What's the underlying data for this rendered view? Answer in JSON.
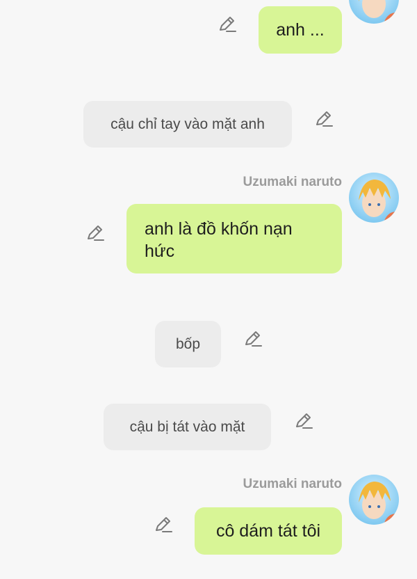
{
  "messages": [
    {
      "role": "user",
      "text": "anh ..."
    },
    {
      "role": "narration",
      "text": "cậu chỉ tay vào mặt anh"
    },
    {
      "role": "user",
      "name": "Uzumaki naruto",
      "text": "anh là đồ khốn nạn hức"
    },
    {
      "role": "narration",
      "text": "bốp"
    },
    {
      "role": "narration",
      "text": "cậu bị tát vào mặt"
    },
    {
      "role": "user",
      "name": "Uzumaki naruto",
      "text": "cô dám tát tôi"
    }
  ],
  "icons": {
    "edit": "pencil-icon",
    "avatar": "character-avatar"
  },
  "colors": {
    "user_bubble": "#d8f596",
    "narration_bubble": "#ececec",
    "background": "#f7f7f7"
  }
}
